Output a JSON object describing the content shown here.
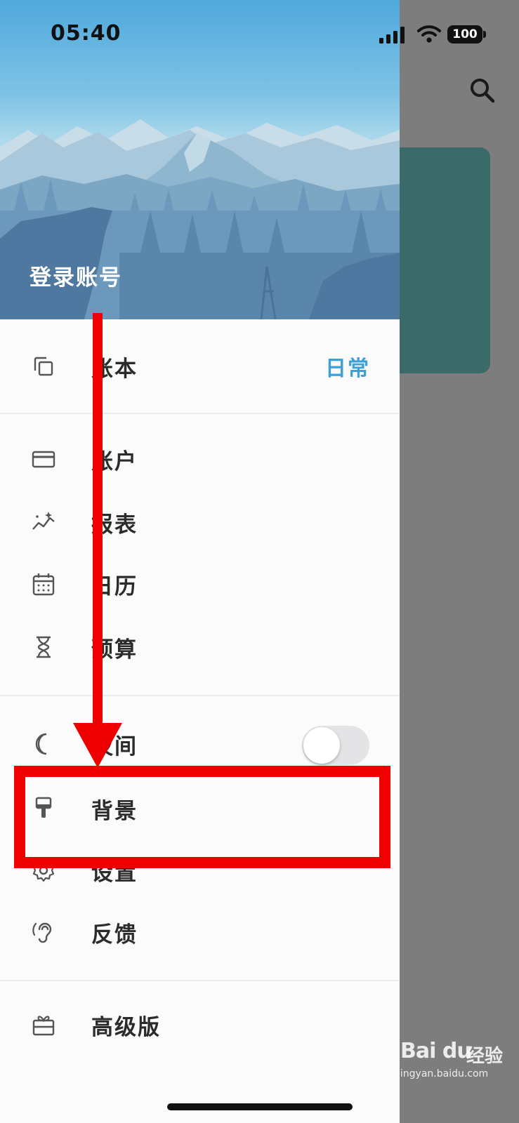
{
  "status_bar": {
    "time": "05:40",
    "battery": "100"
  },
  "header": {
    "login_label": "登录账号"
  },
  "menu": {
    "ledger": {
      "label": "账本",
      "value": "日常",
      "icon": "copy-icon"
    },
    "accounts": {
      "label": "账户",
      "icon": "card-icon"
    },
    "reports": {
      "label": "报表",
      "icon": "chart-sparkle-icon"
    },
    "calendar": {
      "label": "日历",
      "icon": "calendar-icon"
    },
    "budget": {
      "label": "预算",
      "icon": "hourglass-icon"
    },
    "night": {
      "label": "夜间",
      "icon": "moon-icon",
      "toggle_on": false
    },
    "background": {
      "label": "背景",
      "icon": "paint-roller-icon"
    },
    "settings": {
      "label": "设置",
      "icon": "gear-icon"
    },
    "feedback": {
      "label": "反馈",
      "icon": "ear-icon"
    },
    "premium": {
      "label": "高级版",
      "icon": "gift-icon"
    }
  },
  "watermark": {
    "logo": "Bai du",
    "text": "经验",
    "url": "jingyan.baidu.com"
  },
  "colors": {
    "accent": "#3ea0d6",
    "annotation": "#ee0000",
    "teal_card": "#3b6b68"
  }
}
